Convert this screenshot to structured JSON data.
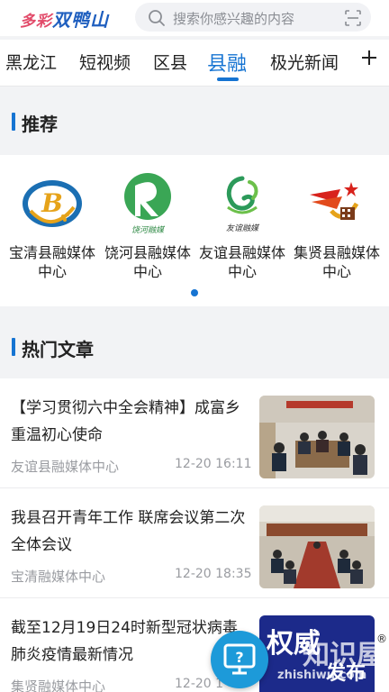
{
  "header": {
    "logo_text": "多彩",
    "logo_text2": "双鸭山",
    "search_placeholder": "搜索你感兴趣的内容"
  },
  "tabs": [
    {
      "label": "黑龙江"
    },
    {
      "label": "短视频"
    },
    {
      "label": "区县"
    },
    {
      "label": "县融",
      "active": true
    },
    {
      "label": "极光新闻"
    }
  ],
  "recommend": {
    "title": "推荐",
    "items": [
      {
        "name_line1": "宝清县融媒体",
        "name_line2": "中心"
      },
      {
        "name_line1": "饶河县融媒体",
        "name_line2": "中心",
        "logo_text": "饶河融媒"
      },
      {
        "name_line1": "友谊县融媒体",
        "name_line2": "中心",
        "logo_text": "友谊融媒"
      },
      {
        "name_line1": "集贤县融媒体",
        "name_line2": "中心"
      }
    ]
  },
  "hot": {
    "title": "热门文章",
    "articles": [
      {
        "title": "【学习贯彻六中全会精神】成富乡 重温初心使命",
        "source": "友谊县融媒体中心",
        "time": "12-20 16:11"
      },
      {
        "title": "我县召开青年工作 联席会议第二次全体会议",
        "source": "宝清融媒体中心",
        "time": "12-20 18:35"
      },
      {
        "title": "截至12月19日24时新型冠状病毒肺炎疫情最新情况",
        "source": "集贤融媒体中心",
        "time": "12-20 1"
      }
    ],
    "thumb3_text": "权威",
    "thumb3_text2": "发布"
  },
  "watermark": {
    "text": "知识屋",
    "url": "zhishiwu.com",
    "mark": "®"
  },
  "colors": {
    "accent": "#1674d2",
    "fab": "#1d9ad9"
  }
}
